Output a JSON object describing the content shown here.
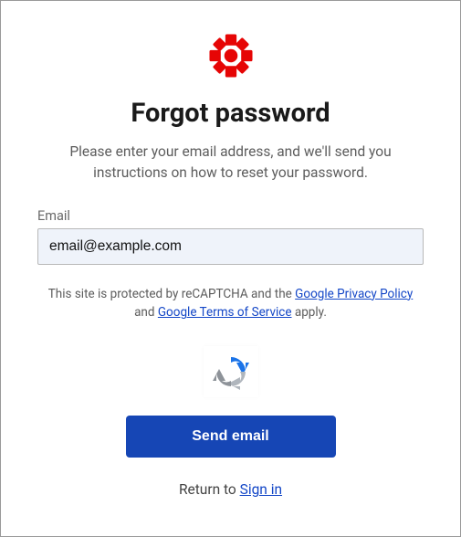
{
  "brand": {
    "color": "#e60505"
  },
  "heading": "Forgot password",
  "subtitle": "Please enter your email address, and we'll send you instructions on how to reset your password.",
  "email": {
    "label": "Email",
    "value": "email@example.com"
  },
  "disclaimer": {
    "prefix": "This site is protected by reCAPTCHA and the ",
    "privacy_link": "Google Privacy Policy",
    "middle": " and ",
    "terms_link": "Google Terms of Service",
    "suffix": " apply."
  },
  "buttons": {
    "send": "Send email"
  },
  "return": {
    "prefix": "Return to ",
    "link": "Sign in"
  }
}
